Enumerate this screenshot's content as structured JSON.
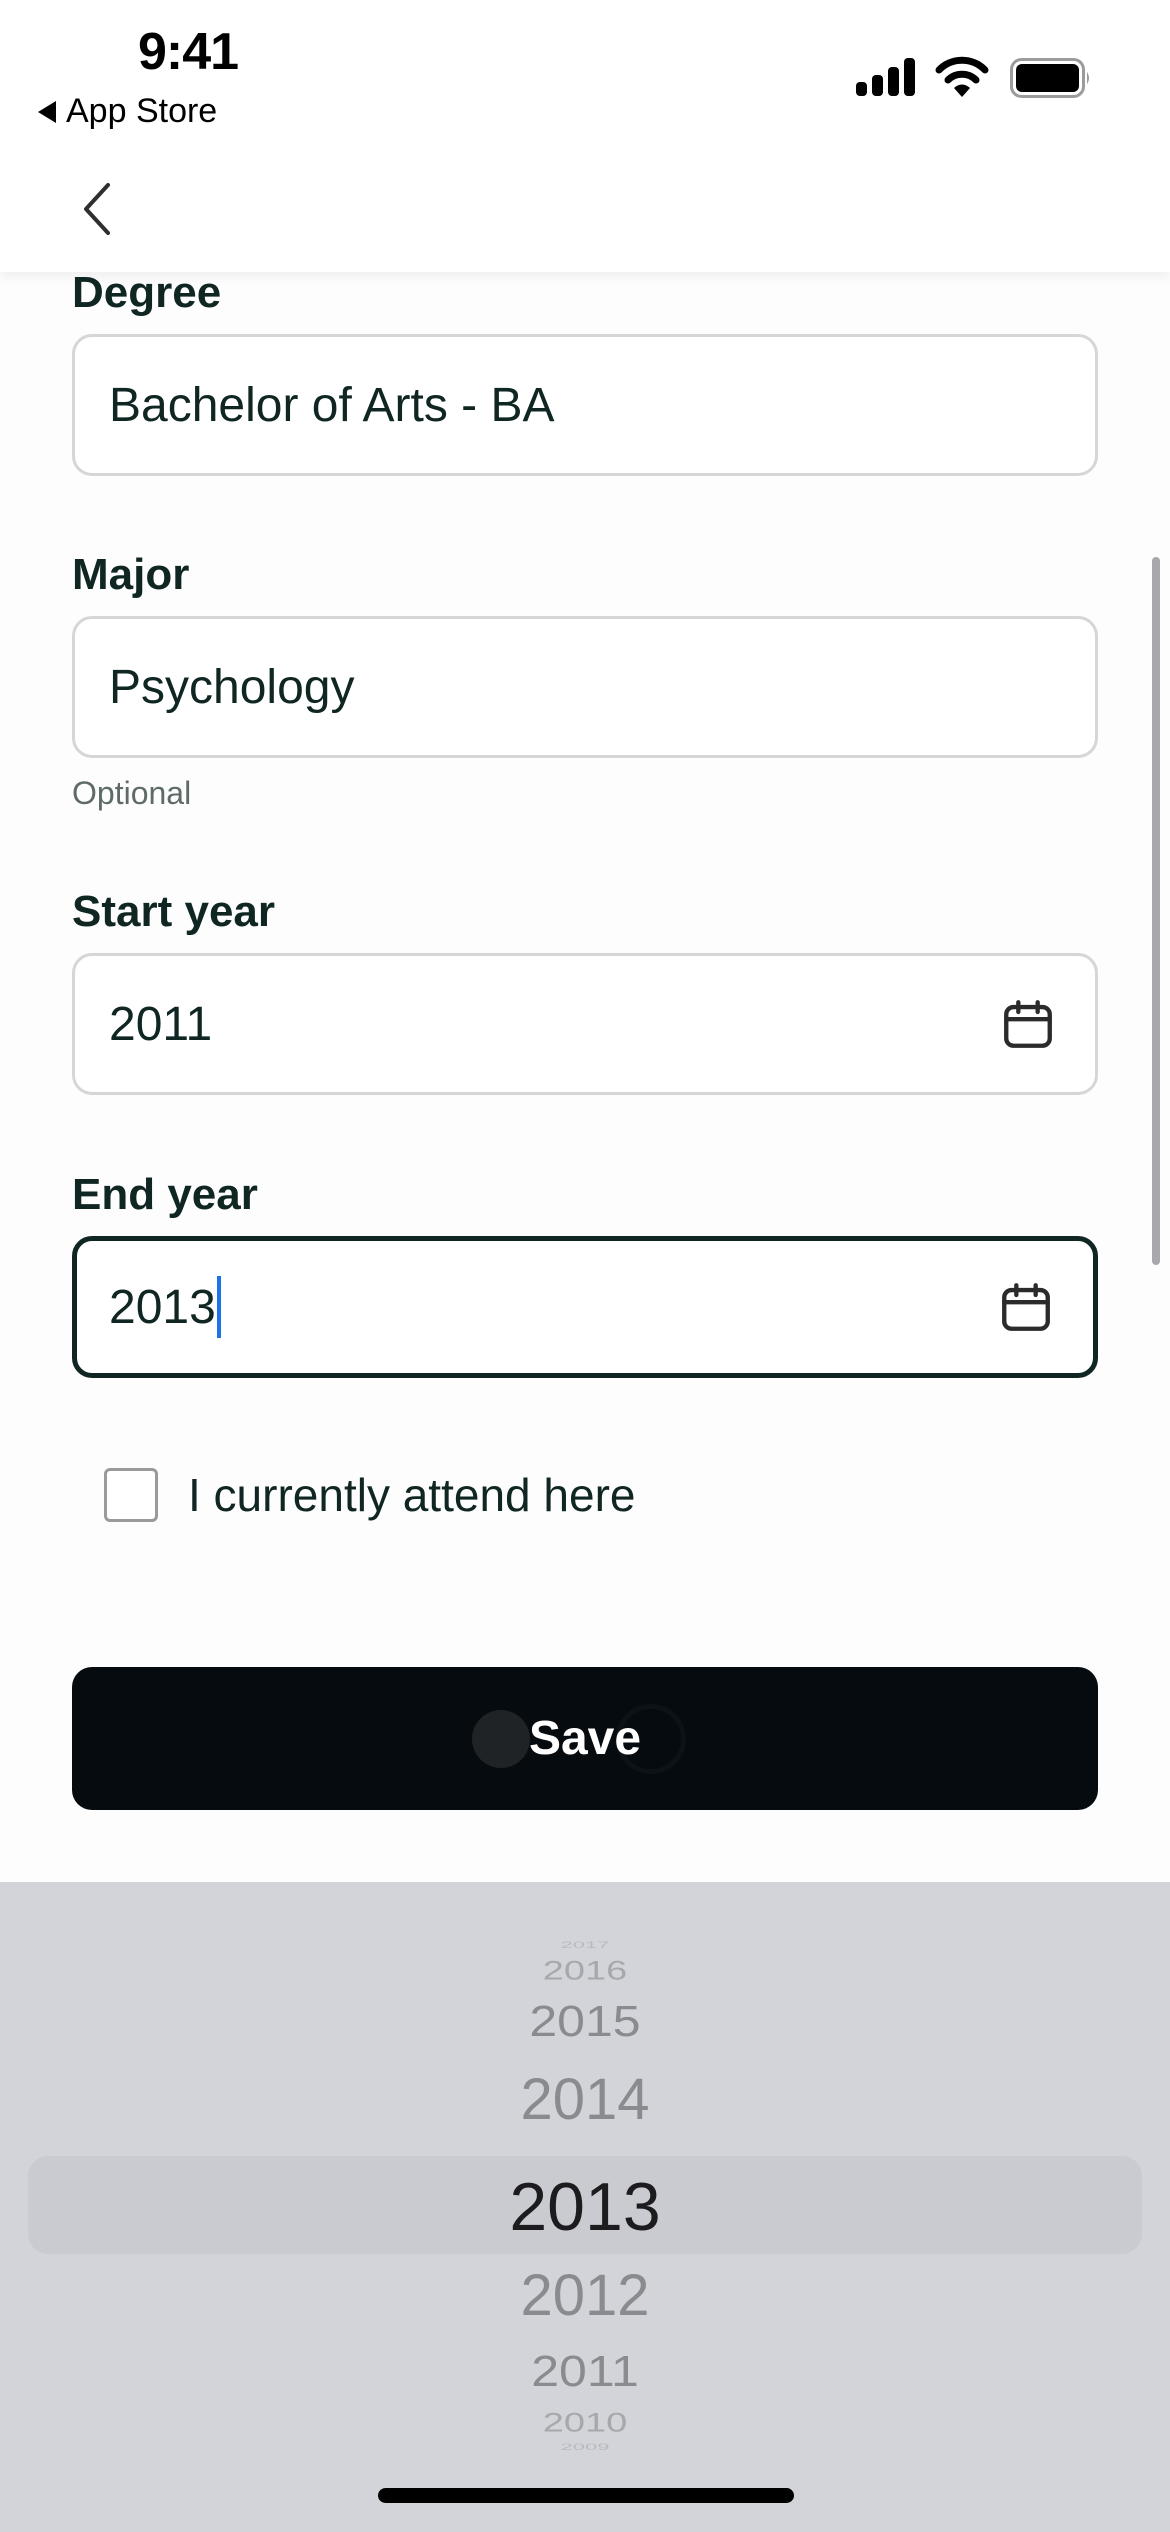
{
  "status_bar": {
    "time": "9:41",
    "back_app_label": "App Store",
    "icons": [
      "signal-icon",
      "wifi-icon",
      "battery-icon"
    ]
  },
  "header": {
    "back_icon": "chevron-left-icon"
  },
  "form": {
    "degree": {
      "label": "Degree",
      "value": "Bachelor of Arts - BA"
    },
    "major": {
      "label": "Major",
      "value": "Psychology",
      "helper": "Optional"
    },
    "start_year": {
      "label": "Start year",
      "value": "2011",
      "icon": "calendar-icon"
    },
    "end_year": {
      "label": "End year",
      "value": "2013",
      "icon": "calendar-icon",
      "focused": true
    },
    "currently_attend": {
      "label": "I currently attend here",
      "checked": false
    },
    "save_label": "Save"
  },
  "picker": {
    "items": [
      "2017",
      "2016",
      "2015",
      "2014",
      "2013",
      "2012",
      "2011",
      "2010",
      "2009"
    ],
    "selected": "2013"
  },
  "colors": {
    "text": "#0f2622",
    "button_bg": "#050b0f",
    "caret": "#1a73e8",
    "picker_bg": "#d2d4d9"
  }
}
